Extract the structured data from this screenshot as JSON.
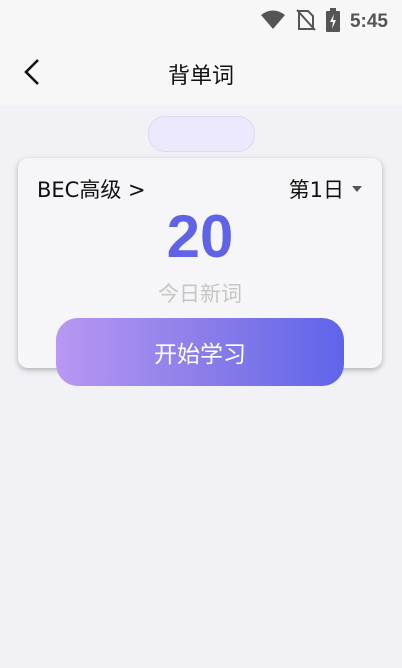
{
  "status_bar": {
    "time": "5:45",
    "icons": [
      "wifi-icon",
      "no-sim-icon",
      "battery-charging-icon"
    ]
  },
  "header": {
    "title": "背单词",
    "back_icon": "chevron-left-icon"
  },
  "card": {
    "course_label": "BEC高级 >",
    "day_label": "第1日",
    "new_words_count": "20",
    "new_words_label": "今日新词"
  },
  "start_button": {
    "label": "开始学习"
  },
  "colors": {
    "accent": "#6163e6",
    "gradient_start": "#b898f2",
    "gradient_end": "#5f64ea",
    "background": "#f2f1f6"
  }
}
